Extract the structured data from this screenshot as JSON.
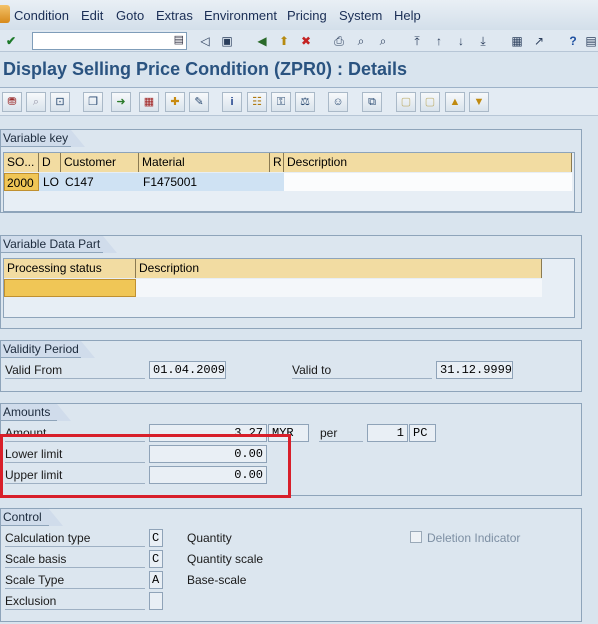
{
  "menu": [
    "Condition",
    "Edit",
    "Goto",
    "Extras",
    "Environment",
    "Pricing",
    "System",
    "Help"
  ],
  "command_field": "",
  "title": "Display Selling Price Condition (ZPR0) : Details",
  "variable_key": {
    "tab": "Variable key",
    "columns": [
      "SO...",
      "D",
      "Customer",
      "Material",
      "R",
      "Description"
    ],
    "row": [
      "2000",
      "LO",
      "C147",
      "F1475001",
      "",
      ""
    ]
  },
  "variable_data": {
    "tab": "Variable Data Part",
    "columns": [
      "Processing status",
      "Description"
    ],
    "row": [
      "",
      ""
    ]
  },
  "validity": {
    "tab": "Validity Period",
    "valid_from_label": "Valid From",
    "valid_from": "01.04.2009",
    "valid_to_label": "Valid to",
    "valid_to": "31.12.9999"
  },
  "amounts": {
    "tab": "Amounts",
    "amount_label": "Amount",
    "amount": "3.27",
    "currency": "MYR",
    "per_label": "per",
    "per_value": "1",
    "unit": "PC",
    "lower_label": "Lower limit",
    "lower_value": "0.00",
    "upper_label": "Upper limit",
    "upper_value": "0.00"
  },
  "control": {
    "tab": "Control",
    "calc_type_label": "Calculation type",
    "calc_type": "C",
    "calc_type_text": "Quantity",
    "scale_basis_label": "Scale basis",
    "scale_basis": "C",
    "scale_basis_text": "Quantity scale",
    "scale_type_label": "Scale Type",
    "scale_type": "A",
    "scale_type_text": "Base-scale",
    "exclusion_label": "Exclusion",
    "exclusion": "",
    "deletion_label": "Deletion Indicator"
  },
  "colors": {
    "header_yellow": "#f2dca2",
    "highlight_red": "#d81f2a",
    "title_blue": "#2a5380"
  }
}
